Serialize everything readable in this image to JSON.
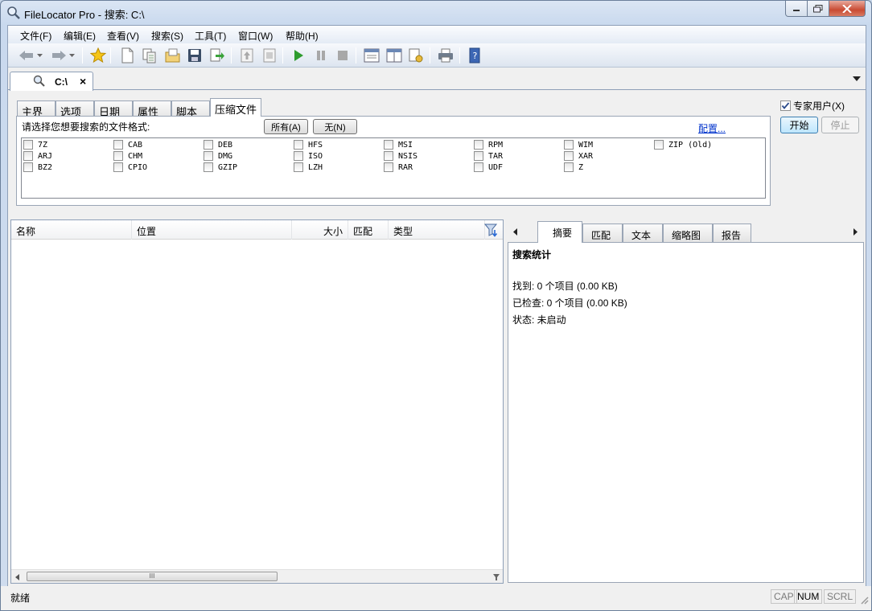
{
  "window": {
    "title": "FileLocator Pro - 搜索: C:\\"
  },
  "menu": {
    "items": [
      "文件(F)",
      "编辑(E)",
      "查看(V)",
      "搜索(S)",
      "工具(T)",
      "窗口(W)",
      "帮助(H)"
    ]
  },
  "doc_tab": {
    "label": "C:\\",
    "close": "×"
  },
  "criteria_tabs": [
    "主界面",
    "选项",
    "日期",
    "属性",
    "脚本",
    "压缩文件"
  ],
  "archive_panel": {
    "prompt": "请选择您想要搜索的文件格式:",
    "all_button": "所有(A)",
    "none_button": "无(N)",
    "config_link": "配置...",
    "formats": [
      "7Z",
      "CAB",
      "DEB",
      "HFS",
      "MSI",
      "RPM",
      "WIM",
      "ZIP (Old)",
      "ARJ",
      "CHM",
      "DMG",
      "ISO",
      "NSIS",
      "TAR",
      "XAR",
      "BZ2",
      "CPIO",
      "GZIP",
      "LZH",
      "RAR",
      "UDF",
      "Z"
    ]
  },
  "side": {
    "expert_label": "专家用户(X)",
    "expert_checked": true,
    "start_button": "开始",
    "stop_button": "停止"
  },
  "results": {
    "columns": [
      "名称",
      "位置",
      "大小",
      "匹配",
      "类型"
    ],
    "scroll_grip": "III"
  },
  "detail": {
    "tabs": [
      "摘要",
      "匹配",
      "文本",
      "缩略图",
      "报告"
    ],
    "heading": "搜索统计",
    "found": "找到: 0 个项目 (0.00 KB)",
    "checked": "已检查: 0 个项目 (0.00 KB)",
    "state": "状态: 未启动"
  },
  "status": {
    "text": "就绪",
    "cap": "CAP",
    "num": "NUM",
    "scrl": "SCRL"
  },
  "colors": {
    "accent_blue": "#2a6ad4",
    "link": "#0033cc",
    "play_green": "#2e9c2e"
  }
}
